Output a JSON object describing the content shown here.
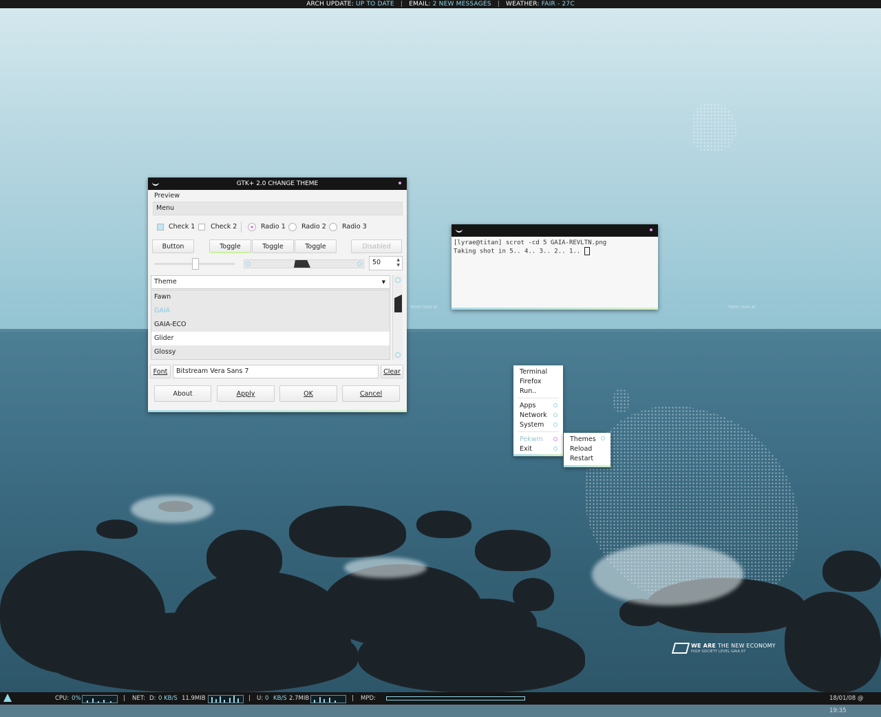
{
  "top_bar": {
    "arch_label": "ARCH UPDATE:",
    "arch_value": "UP TO DATE",
    "email_label": "EMAIL:",
    "email_value": "2 NEW MESSAGES",
    "weather_label": "WEATHER:",
    "weather_value": "FAIR - 27C",
    "separator": "|"
  },
  "gtk_window": {
    "title": "GTK+ 2.0 CHANGE THEME",
    "preview_label": "Preview",
    "menu_label": "Menu",
    "check1": "Check 1",
    "check2": "Check 2",
    "radio1": "Radio 1",
    "radio2": "Radio 2",
    "radio3": "Radio 3",
    "button": "Button",
    "toggle1": "Toggle",
    "toggle2": "Toggle",
    "toggle3": "Toggle",
    "disabled": "Disabled",
    "spin_value": "50",
    "theme_header": "Theme",
    "themes": [
      "Fawn",
      "GAIA",
      "GAIA-ECO",
      "Glider",
      "Glossy"
    ],
    "font_label": "Font",
    "font_value": "Bitstream Vera Sans 7",
    "clear": "Clear",
    "about": "About",
    "apply": "Apply",
    "ok": "OK",
    "cancel": "Cancel"
  },
  "terminal": {
    "line1": "[lyrae@titan] scrot -cd 5 GAIA-REVLTN.png",
    "line2": "Taking shot in 5.. 4.. 3.. 2.. 1.."
  },
  "root_menu": {
    "items": [
      "Terminal",
      "Firefox",
      "Run.."
    ],
    "submenus": [
      "Apps",
      "Network",
      "System"
    ],
    "wm": "Pekwm",
    "exit": "Exit"
  },
  "pekwm_menu": {
    "items": [
      "Themes",
      "Reload",
      "Restart"
    ]
  },
  "wallpaper": {
    "tag_bold": "WE ARE",
    "tag_rest": "THE NEW ECONOMY",
    "tag_sub": "HIGH SOCIETY LEVEL GAIA 07"
  },
  "bottom_bar": {
    "cpu_label": "CPU:",
    "cpu_value": "0%",
    "net_label": "NET:",
    "down_label": "D:",
    "down_rate": "0 KB/S",
    "down_total": "11.9MIB",
    "up_label": "U:",
    "up_rate_value": "0",
    "up_rate_unit": "KB/S",
    "up_total": "2.7MIB",
    "mpd_label": "MPD:",
    "datetime": "18/01/08 @ 19:35",
    "separator": "|"
  },
  "colors": {
    "accent": "#8fd8ea",
    "panel": "#161616",
    "highlight_pink": "#e587e8",
    "lime_accent": "#d9f0c7"
  }
}
